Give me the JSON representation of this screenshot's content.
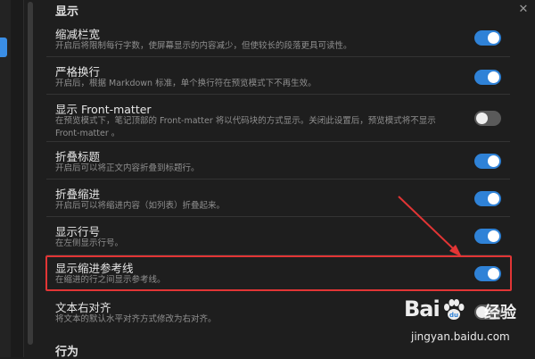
{
  "section_display": "显示",
  "section_behavior": "行为",
  "settings": [
    {
      "name": "缩减栏宽",
      "desc": "开启后将限制每行字数，使屏幕显示的内容减少，但使较长的段落更具可读性。",
      "state": "on"
    },
    {
      "name": "严格换行",
      "desc": "开启后，根据 Markdown 标准，单个换行符在预览模式下不再生效。",
      "state": "on"
    },
    {
      "name": "显示 Front-matter",
      "desc": "在预览模式下，笔记顶部的 Front-matter 将以代码块的方式显示。关闭此设置后，预览模式将不显示 Front-matter 。",
      "state": "off"
    },
    {
      "name": "折叠标题",
      "desc": "开启后可以将正文内容折叠到标题行。",
      "state": "on"
    },
    {
      "name": "折叠缩进",
      "desc": "开启后可以将缩进内容（如列表）折叠起来。",
      "state": "on"
    },
    {
      "name": "显示行号",
      "desc": "在左侧显示行号。",
      "state": "on"
    },
    {
      "name": "显示缩进参考线",
      "desc": "在缩进的行之间显示参考线。",
      "state": "on"
    },
    {
      "name": "文本右对齐",
      "desc": "将文本的默认水平对齐方式修改为右对齐。",
      "state": "off"
    }
  ],
  "watermark": {
    "brand": "Bai",
    "jingyan": "经验",
    "url": "jingyan.baidu.com"
  },
  "colors": {
    "accent": "#2f82d7",
    "highlight": "#e23535",
    "background": "#1e1e1e"
  },
  "icons": {
    "close": "close-icon"
  }
}
